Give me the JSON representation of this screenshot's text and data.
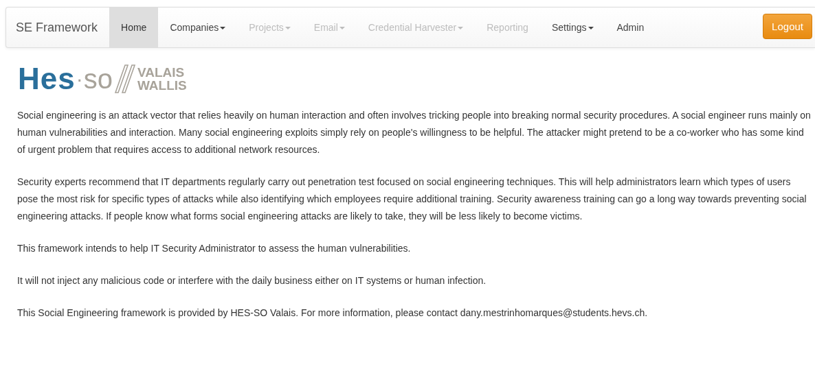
{
  "navbar": {
    "brand": "SE Framework",
    "items": [
      {
        "label": "Home",
        "dropdown": false,
        "disabled": false,
        "selected": true
      },
      {
        "label": "Companies",
        "dropdown": true,
        "disabled": false,
        "selected": false
      },
      {
        "label": "Projects",
        "dropdown": true,
        "disabled": true,
        "selected": false
      },
      {
        "label": "Email",
        "dropdown": true,
        "disabled": true,
        "selected": false
      },
      {
        "label": "Credential Harvester",
        "dropdown": true,
        "disabled": true,
        "selected": false
      },
      {
        "label": "Reporting",
        "dropdown": false,
        "disabled": true,
        "selected": false
      },
      {
        "label": "Settings",
        "dropdown": true,
        "disabled": false,
        "selected": false
      },
      {
        "label": "Admin",
        "dropdown": false,
        "disabled": false,
        "selected": false
      }
    ],
    "logout": "Logout"
  },
  "logo": {
    "main": "Hes",
    "dot": "·",
    "second": "so",
    "line_1": "VALAIS",
    "line_2": "WALLIS"
  },
  "paragraphs": [
    {
      "text": "Social engineering is an attack vector that relies heavily on human interaction and often involves tricking people into breaking normal security procedures. A social engineer runs mainly on human vulnerabilities and interaction. Many social engineering exploits simply rely on people's willingness to be helpful. The attacker might pretend to be a co-worker who has some kind of urgent problem that requires access to additional network resources."
    },
    {
      "text": "Security experts recommend that IT departments regularly carry out penetration test focused on social engineering techniques. This will help administrators learn which types of users pose the most risk for specific types of attacks while also identifying which employees require additional training. Security awareness training can go a long way towards preventing social engineering attacks. If people know what forms social engineering attacks are likely to take, they will be less likely to become victims."
    },
    {
      "text": "This framework intends to help IT Security Administrator to assess the human vulnerabilities."
    },
    {
      "text": "It will not inject any malicious code or interfere with the daily business either on IT systems or human infection."
    },
    {
      "text": "This Social Engineering framework is provided by HES-SO Valais. For more information, please contact",
      "link": "dany.mestrinhomarques@students.hevs.ch."
    }
  ]
}
